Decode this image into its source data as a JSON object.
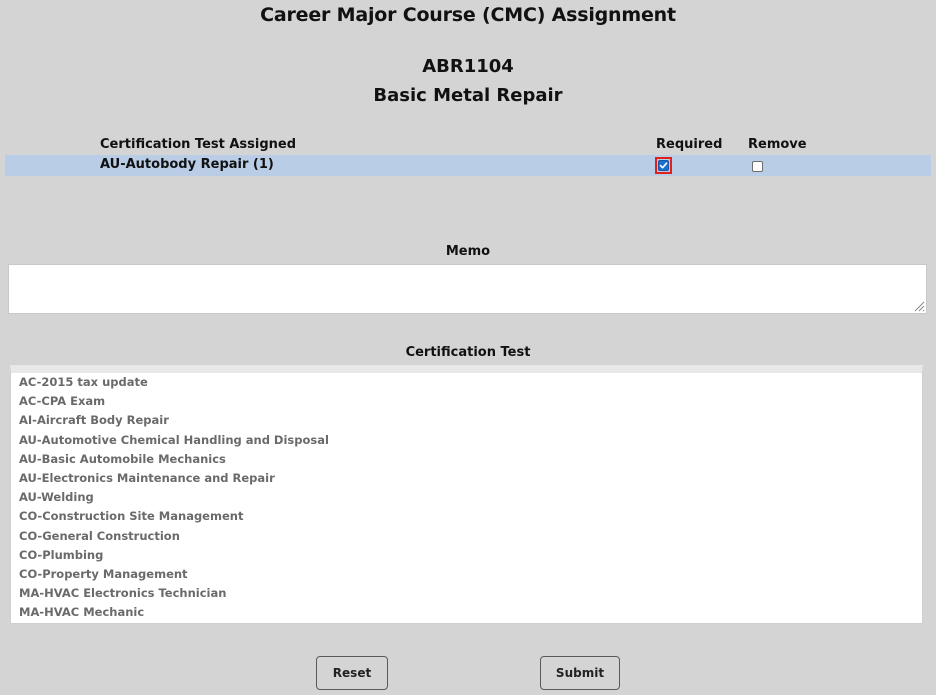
{
  "page": {
    "title": "Career Major Course (CMC) Assignment",
    "course_code": "ABR1104",
    "course_name": "Basic Metal Repair"
  },
  "assigned_table": {
    "headers": {
      "certification": "Certification Test Assigned",
      "required": "Required",
      "remove": "Remove"
    },
    "rows": [
      {
        "label": "AU-Autobody Repair (1)",
        "required": true,
        "remove": false
      }
    ]
  },
  "memo": {
    "label": "Memo",
    "value": ""
  },
  "certification_test": {
    "label": "Certification Test",
    "items": [
      "AC-2015 tax update",
      "AC-CPA Exam",
      "AI-Aircraft Body Repair",
      "AU-Automotive Chemical Handling and Disposal",
      "AU-Basic Automobile Mechanics",
      "AU-Electronics Maintenance and Repair",
      "AU-Welding",
      "CO-Construction Site Management",
      "CO-General Construction",
      "CO-Plumbing",
      "CO-Property Management",
      "MA-HVAC Electronics Technician",
      "MA-HVAC Mechanic"
    ]
  },
  "buttons": {
    "reset": "Reset",
    "submit": "Submit"
  },
  "colors": {
    "background": "#d4d4d4",
    "selected_row": "#b9cde6",
    "checkbox_checked": "#1a6fd1",
    "focus_outline": "#e0201a"
  },
  "icons": {
    "checkmark": "check-icon",
    "resize_grip": "resize-grip-icon"
  }
}
